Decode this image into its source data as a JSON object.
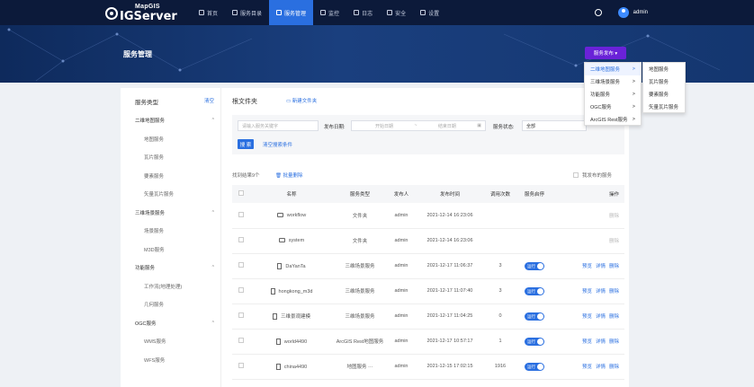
{
  "app": {
    "logo_small": "MapGIS",
    "logo_big": "IGServer"
  },
  "nav": [
    {
      "label": "首页",
      "active": false
    },
    {
      "label": "服务目录",
      "active": false
    },
    {
      "label": "服务管理",
      "active": true
    },
    {
      "label": "监控",
      "active": false
    },
    {
      "label": "日志",
      "active": false
    },
    {
      "label": "安全",
      "active": false
    },
    {
      "label": "设置",
      "active": false
    }
  ],
  "user": {
    "name": "admin"
  },
  "page": {
    "title": "服务管理",
    "publish_label": "服务发布 ▾"
  },
  "publish_menu": {
    "items": [
      {
        "label": "二维地图服务",
        "arrow": ">"
      },
      {
        "label": "三维场景服务",
        "arrow": ">"
      },
      {
        "label": "功能服务",
        "arrow": ">"
      },
      {
        "label": "OGC服务",
        "arrow": ">"
      },
      {
        "label": "ArcGIS Rest服务",
        "arrow": ">"
      }
    ],
    "submenu": [
      "地图服务",
      "瓦片服务",
      "要素服务",
      "矢量瓦片服务"
    ]
  },
  "sidebar": {
    "title": "服务类型",
    "clear": "清空",
    "rows": [
      {
        "label": "二维地图服务",
        "type": "group",
        "chev": "^"
      },
      {
        "label": "地图服务",
        "type": "sub"
      },
      {
        "label": "瓦片服务",
        "type": "sub"
      },
      {
        "label": "要素服务",
        "type": "sub"
      },
      {
        "label": "矢量瓦片服务",
        "type": "sub"
      },
      {
        "label": "三维场景服务",
        "type": "group",
        "chev": "^"
      },
      {
        "label": "场景服务",
        "type": "sub"
      },
      {
        "label": "M3D服务",
        "type": "sub"
      },
      {
        "label": "功能服务",
        "type": "group",
        "chev": "^"
      },
      {
        "label": "工作流(地理处理)",
        "type": "sub"
      },
      {
        "label": "几何服务",
        "type": "sub"
      },
      {
        "label": "OGC服务",
        "type": "group",
        "chev": "^"
      },
      {
        "label": "WMS服务",
        "type": "sub"
      },
      {
        "label": "WFS服务",
        "type": "sub"
      }
    ]
  },
  "content": {
    "folder_title": "根文件夹",
    "new_folder": "新建文件夹",
    "filters": {
      "keyword_placeholder": "请输入服务关键字",
      "date_label": "发布日期:",
      "start_placeholder": "开始日期",
      "date_sep": "~",
      "end_placeholder": "结束日期",
      "status_label": "服务状态:",
      "status_value": "全部",
      "search_btn": "搜 索",
      "clear_link": "清空搜索条件"
    },
    "found": "找到结果9个",
    "batch_delete": "批量删除",
    "my_published": "我发布的服务",
    "columns": [
      "名称",
      "服务类型",
      "发布人",
      "发布时间",
      "调用次数",
      "服务启停",
      "操作"
    ],
    "rows": [
      {
        "name": "workflow",
        "icon": "folder",
        "link": true,
        "type": "文件夹",
        "publisher": "admin",
        "time": "2021-12-14 16:23:06",
        "calls": "",
        "toggle": "",
        "ops": [
          "删除"
        ],
        "ops_disabled": true
      },
      {
        "name": "system",
        "icon": "folder",
        "link": true,
        "type": "文件夹",
        "publisher": "admin",
        "time": "2021-12-14 16:23:06",
        "calls": "",
        "toggle": "",
        "ops": [
          "删除"
        ],
        "ops_disabled": true
      },
      {
        "name": "DaYanTa",
        "icon": "doc",
        "link": false,
        "type": "三维场景服务",
        "publisher": "admin",
        "time": "2021-12-17 11:06:37",
        "calls": "3",
        "toggle": "运行",
        "ops": [
          "预览",
          "详情",
          "删除"
        ],
        "ops_disabled": false
      },
      {
        "name": "hongkong_m3d",
        "icon": "doc",
        "link": false,
        "type": "三维场景服务",
        "publisher": "admin",
        "time": "2021-12-17 11:07:40",
        "calls": "3",
        "toggle": "运行",
        "ops": [
          "预览",
          "详情",
          "删除"
        ],
        "ops_disabled": false
      },
      {
        "name": "三维景观建模",
        "icon": "doc",
        "link": false,
        "type": "三维场景服务",
        "publisher": "admin",
        "time": "2021-12-17 11:04:25",
        "calls": "0",
        "toggle": "运行",
        "ops": [
          "预览",
          "详情",
          "删除"
        ],
        "ops_disabled": false
      },
      {
        "name": "world4490",
        "icon": "doc",
        "link": false,
        "type": "ArcGIS Rest地图服务",
        "publisher": "admin",
        "time": "2021-12-17 10:57:17",
        "calls": "1",
        "toggle": "运行",
        "ops": [
          "预览",
          "详情",
          "删除"
        ],
        "ops_disabled": false
      },
      {
        "name": "china4490",
        "icon": "doc",
        "link": false,
        "type": "地图服务 ···",
        "publisher": "admin",
        "time": "2021-12-15 17:02:15",
        "calls": "1916",
        "toggle": "运行",
        "ops": [
          "预览",
          "详情",
          "删除"
        ],
        "ops_disabled": false
      }
    ]
  }
}
